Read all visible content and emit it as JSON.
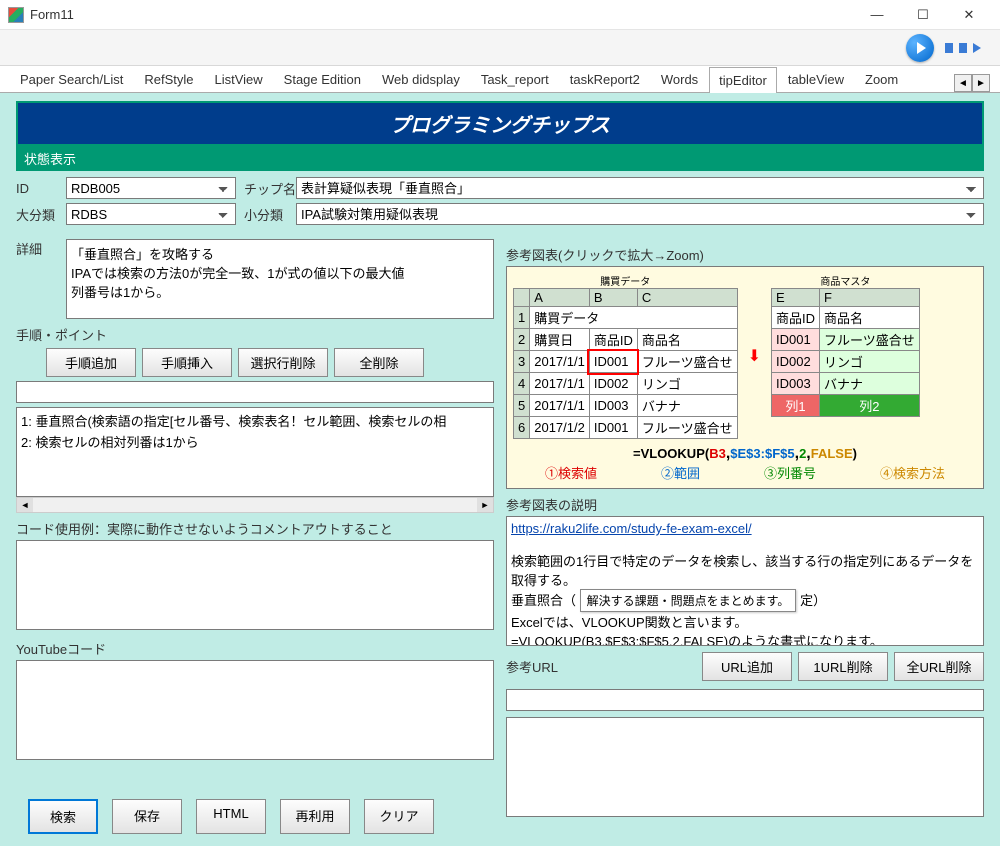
{
  "window": {
    "title": "Form11"
  },
  "tabs": {
    "items": [
      "Paper Search/List",
      "RefStyle",
      "ListView",
      "Stage Edition",
      "Web didsplay",
      "Task_report",
      "taskReport2",
      "Words",
      "tipEditor",
      "tableView",
      "Zoom"
    ],
    "active": "tipEditor"
  },
  "banner": "プログラミングチップス",
  "status_label": "状態表示",
  "labels": {
    "id": "ID",
    "chip_name": "チップ名",
    "large_cat": "大分類",
    "small_cat": "小分類",
    "detail": "詳細",
    "procedure": "手順・ポイント",
    "code_example": "コード使用例：実際に動作させないようコメントアウトすること",
    "youtube": "YouTubeコード",
    "ref_image": "参考図表(クリックで拡大→Zoom)",
    "ref_desc": "参考図表の説明",
    "ref_url": "参考URL"
  },
  "fields": {
    "id": "RDB005",
    "chip_name": "表計算疑似表現「垂直照合」",
    "large_cat": "RDBS",
    "small_cat": "IPA試験対策用疑似表現",
    "detail": "「垂直照合」を攻略する\nIPAでは検索の方法0が完全一致、1が式の値以下の最大値\n列番号は1から。",
    "code_example": "",
    "youtube": ""
  },
  "procedure_buttons": {
    "add": "手順追加",
    "insert": "手順挿入",
    "delrow": "選択行削除",
    "delall": "全削除"
  },
  "procedure_items": [
    "1: 垂直照合(検索語の指定[セル番号、検索表名！セル範囲、検索セルの相",
    "2: 検索セルの相対列番は1から"
  ],
  "ref_image_data": {
    "left_title": "購買データ",
    "right_title": "商品マスタ",
    "left_headers": [
      "購買日",
      "商品ID",
      "商品名"
    ],
    "right_headers": [
      "商品ID",
      "商品名"
    ],
    "left_rows": [
      [
        "2017/1/1",
        "ID001",
        "フルーツ盛合せ"
      ],
      [
        "2017/1/1",
        "ID002",
        "リンゴ"
      ],
      [
        "2017/1/1",
        "ID003",
        "バナナ"
      ],
      [
        "2017/1/2",
        "ID001",
        "フルーツ盛合せ"
      ]
    ],
    "right_rows": [
      [
        "ID001",
        "フルーツ盛合せ"
      ],
      [
        "ID002",
        "リンゴ"
      ],
      [
        "ID003",
        "バナナ"
      ]
    ],
    "tags": {
      "left": "列1",
      "right": "列2"
    },
    "formula_prefix": "=VLOOKUP(",
    "formula_p1": "B3",
    "formula_p2": "$E$3:$F$5",
    "formula_p3": "2",
    "formula_p4": "FALSE",
    "formula_suffix": ")",
    "legend": {
      "p1": "①検索値",
      "p2": "②範囲",
      "p3": "③列番号",
      "p4": "④検索方法"
    }
  },
  "ref_desc": {
    "link": "https://raku2life.com/study-fe-exam-excel/",
    "text1": "検索範囲の1行目で特定のデータを検索し、該当する行の指定列にあるデータを取得する。",
    "text2_prefix": "垂直照合（ ",
    "text2_suffix": "定）",
    "tooltip": "解決する課題・問題点をまとめます。",
    "text3": "Excelでは、VLOOKUP関数と言います。",
    "text4": "=VLOOKUP(B3,$E$3:$F$5,2,FALSE)のような書式になります。"
  },
  "url_buttons": {
    "add": "URL追加",
    "del1": "1URL削除",
    "delall": "全URL削除"
  },
  "bottom_buttons": {
    "search": "検索",
    "save": "保存",
    "html": "HTML",
    "reuse": "再利用",
    "clear": "クリア"
  }
}
